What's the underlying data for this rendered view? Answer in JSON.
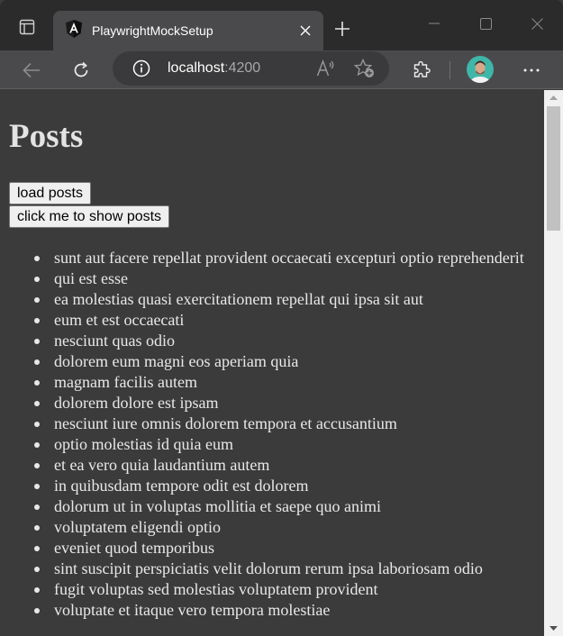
{
  "browser": {
    "tab": {
      "title": "PlaywrightMockSetup",
      "favicon": "angular-icon"
    },
    "address_bar": {
      "host": "localhost",
      "port": ":4200"
    },
    "icons": {
      "tab_actions": "tab-actions-icon",
      "close_tab": "close-icon",
      "new_tab": "plus-icon",
      "minimize": "minimize-icon",
      "maximize": "maximize-icon",
      "close_window": "close-icon",
      "back": "back-arrow-icon",
      "refresh": "refresh-icon",
      "site_info": "info-icon",
      "read_aloud": "read-aloud-icon",
      "favorites": "add-favorite-icon",
      "extensions": "puzzle-icon",
      "profile": "avatar",
      "more": "more-icon"
    }
  },
  "page": {
    "title": "Posts",
    "buttons": {
      "load_posts": "load posts",
      "show_posts": "click me to show posts"
    },
    "posts": [
      "sunt aut facere repellat provident occaecati excepturi optio reprehenderit",
      "qui est esse",
      "ea molestias quasi exercitationem repellat qui ipsa sit aut",
      "eum et est occaecati",
      "nesciunt quas odio",
      "dolorem eum magni eos aperiam quia",
      "magnam facilis autem",
      "dolorem dolore est ipsam",
      "nesciunt iure omnis dolorem tempora et accusantium",
      "optio molestias id quia eum",
      "et ea vero quia laudantium autem",
      "in quibusdam tempore odit est dolorem",
      "dolorum ut in voluptas mollitia et saepe quo animi",
      "voluptatem eligendi optio",
      "eveniet quod temporibus",
      "sint suscipit perspiciatis velit dolorum rerum ipsa laboriosam odio",
      "fugit voluptas sed molestias voluptatem provident",
      "voluptate et itaque vero tempora molestiae"
    ]
  },
  "colors": {
    "page_background": "#3b3b3b",
    "text": "#e8e8e8",
    "tab_active": "#4a4a4d",
    "avatar_bg": "#3fb6a8"
  }
}
